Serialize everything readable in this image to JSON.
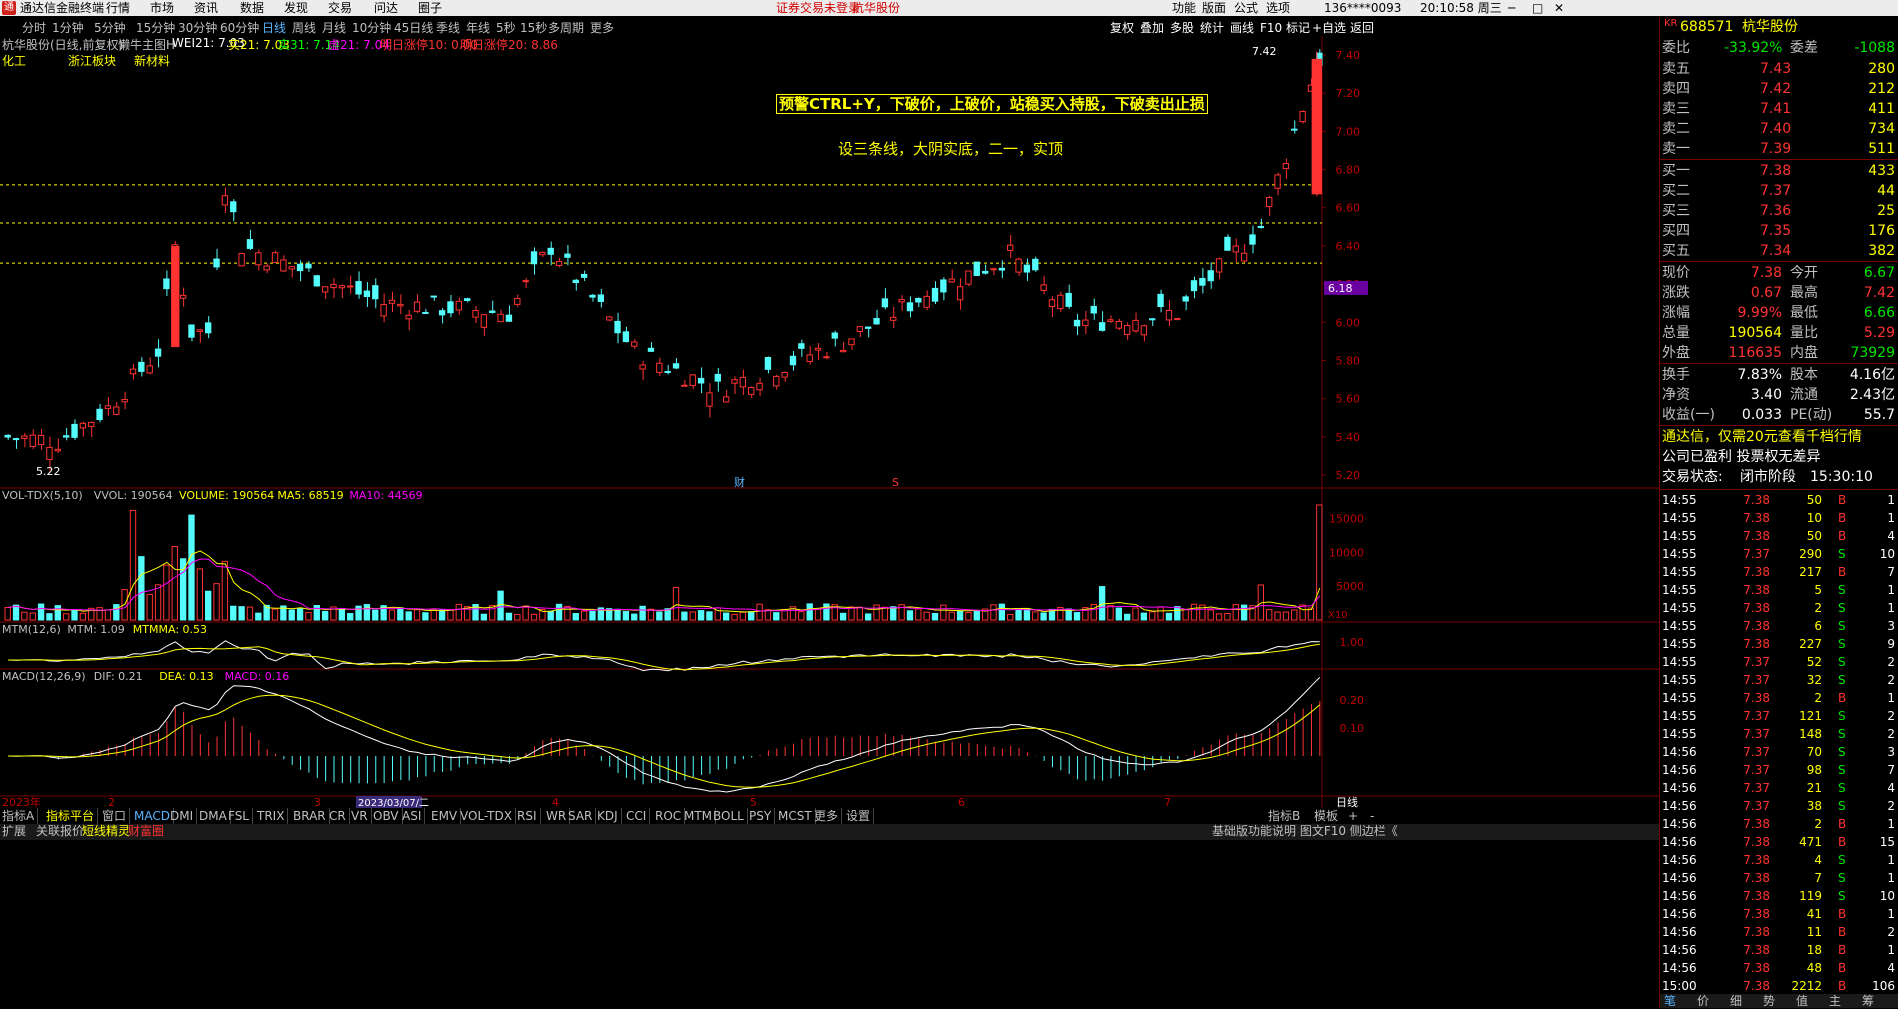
{
  "menubar": {
    "app_title": "通达信金融终端",
    "menus": [
      "行情",
      "市场",
      "资讯",
      "数据",
      "发现",
      "交易",
      "问达",
      "圈子"
    ],
    "notice": "证券交易未登录",
    "stock_name": "杭华股份",
    "right": [
      "功能",
      "版面",
      "公式",
      "选项"
    ],
    "user": "136****0093",
    "time": "20:10:58 周三"
  },
  "periodbar": {
    "items": [
      "分时",
      "1分钟",
      "5分钟",
      "15分钟",
      "30分钟",
      "60分钟",
      "日线",
      "周线",
      "月线",
      "10分钟",
      "45日线",
      "季线",
      "年线",
      "5秒",
      "15秒",
      "多周期",
      "更多"
    ],
    "active": "日线",
    "right_buttons": [
      "复权",
      "叠加",
      "多股",
      "统计",
      "画线",
      "F10",
      "标记",
      "+自选",
      "返回"
    ]
  },
  "info": {
    "title": "杭华股份(日线,前复权)",
    "indicator": "懒牛主图H",
    "wei21": "WEI21: 7.03",
    "shi21": "实21: 7.03",
    "shi31": "实31: 7.14",
    "xu21": "虚21: 7.04",
    "zt10": "明日涨停10: 0.00",
    "zt20": "明日涨停20: 8.86",
    "tags": [
      "化工",
      "浙江板块",
      "新材料"
    ],
    "annotation1": "预警CTRL+Y，下破价，上破价，站稳买入持股，下破卖出止损",
    "annotation2": "设三条线，大阴实底，二一，实顶",
    "high_label": "7.42",
    "low_label": "5.22",
    "cur_price_tag": "6.18",
    "marker_cai": "财",
    "marker_s": "S"
  },
  "price_axis": [
    "7.40",
    "7.20",
    "7.00",
    "6.80",
    "6.60",
    "6.40",
    "6.20",
    "6.00",
    "5.80",
    "5.60",
    "5.40",
    "5.20"
  ],
  "vol": {
    "title": "VOL-TDX(5,10)",
    "vvol": "VVOL: 190564",
    "volume": "VOLUME: 190564",
    "ma5": "MA5: 68519",
    "ma10": "MA10: 44569",
    "axis": [
      "15000",
      "10000",
      "5000"
    ],
    "unit": "X10"
  },
  "mtm": {
    "title": "MTM(12,6)",
    "mtm": "MTM: 1.09",
    "mtmma": "MTMMA: 0.53",
    "axis": [
      "1.00"
    ]
  },
  "macd": {
    "title": "MACD(12,26,9)",
    "dif": "DIF: 0.21",
    "dea": "DEA: 0.13",
    "macd": "MACD: 0.16",
    "axis": [
      "0.20",
      "0.10"
    ]
  },
  "xaxis": {
    "labels": [
      "2023年",
      "2",
      "3",
      "4",
      "5",
      "6",
      "7"
    ],
    "highlight": "2023/03/07/二",
    "right_label": "日线"
  },
  "tabs": {
    "items": [
      "指标A",
      "指标平台",
      "窗口",
      "MACD",
      "DMI",
      "DMA",
      "FSL",
      "TRIX",
      "BRAR",
      "CR",
      "VR",
      "OBV",
      "ASI",
      "EMV",
      "VOL-TDX",
      "RSI",
      "WR",
      "SAR",
      "KDJ",
      "CCI",
      "ROC",
      "MTM",
      "BOLL",
      "PSY",
      "MCST",
      "更多",
      "设置"
    ],
    "active": "MACD",
    "right": [
      "指标B",
      "模板",
      "+",
      "-"
    ]
  },
  "bottombar": {
    "items": [
      "扩展",
      "关联报价",
      "短线精灵",
      "财富圈"
    ],
    "right_text": "基础版功能说明 图文F10 侧边栏《",
    "right_tabs": [
      "笔",
      "价",
      "细",
      "势",
      "值",
      "主",
      "筹"
    ]
  },
  "quote": {
    "code": "688571",
    "name": "杭华股份",
    "market": "KR",
    "weibi_label": "委比",
    "weibi": "-33.92%",
    "weicha_label": "委差",
    "weicha": "-1088",
    "asks": [
      {
        "label": "卖五",
        "price": "7.43",
        "vol": "280"
      },
      {
        "label": "卖四",
        "price": "7.42",
        "vol": "212"
      },
      {
        "label": "卖三",
        "price": "7.41",
        "vol": "411"
      },
      {
        "label": "卖二",
        "price": "7.40",
        "vol": "734"
      },
      {
        "label": "卖一",
        "price": "7.39",
        "vol": "511"
      }
    ],
    "bids": [
      {
        "label": "买一",
        "price": "7.38",
        "vol": "433"
      },
      {
        "label": "买二",
        "price": "7.37",
        "vol": "44"
      },
      {
        "label": "买三",
        "price": "7.36",
        "vol": "25"
      },
      {
        "label": "买四",
        "price": "7.35",
        "vol": "176"
      },
      {
        "label": "买五",
        "price": "7.34",
        "vol": "382"
      }
    ],
    "stats": [
      {
        "l1": "现价",
        "v1": "7.38",
        "c1": "red",
        "l2": "今开",
        "v2": "6.67",
        "c2": "green"
      },
      {
        "l1": "涨跌",
        "v1": "0.67",
        "c1": "red",
        "l2": "最高",
        "v2": "7.42",
        "c2": "red"
      },
      {
        "l1": "涨幅",
        "v1": "9.99%",
        "c1": "red",
        "l2": "最低",
        "v2": "6.66",
        "c2": "green"
      },
      {
        "l1": "总量",
        "v1": "190564",
        "c1": "yellow",
        "l2": "量比",
        "v2": "5.29",
        "c2": "red"
      },
      {
        "l1": "外盘",
        "v1": "116635",
        "c1": "red",
        "l2": "内盘",
        "v2": "73929",
        "c2": "green"
      }
    ],
    "stats2": [
      {
        "l1": "换手",
        "v1": "7.83%",
        "l2": "股本",
        "v2": "4.16亿"
      },
      {
        "l1": "净资",
        "v1": "3.40",
        "l2": "流通",
        "v2": "2.43亿"
      },
      {
        "l1": "收益(一)",
        "v1": "0.033",
        "l2": "PE(动)",
        "v2": "55.7"
      }
    ],
    "promo": "通达信，仅需20元查看千档行情",
    "company": "公司已盈利 投票权无差异",
    "status_label": "交易状态:",
    "status": "闭市阶段",
    "status_time": "15:30:10"
  },
  "ticks": [
    [
      "14:55",
      "7.38",
      "50",
      "B",
      "1"
    ],
    [
      "14:55",
      "7.38",
      "10",
      "B",
      "1"
    ],
    [
      "14:55",
      "7.38",
      "50",
      "B",
      "4"
    ],
    [
      "14:55",
      "7.37",
      "290",
      "S",
      "10"
    ],
    [
      "14:55",
      "7.38",
      "217",
      "B",
      "7"
    ],
    [
      "14:55",
      "7.38",
      "5",
      "S",
      "1"
    ],
    [
      "14:55",
      "7.38",
      "2",
      "S",
      "1"
    ],
    [
      "14:55",
      "7.38",
      "6",
      "S",
      "3"
    ],
    [
      "14:55",
      "7.38",
      "227",
      "S",
      "9"
    ],
    [
      "14:55",
      "7.37",
      "52",
      "S",
      "2"
    ],
    [
      "14:55",
      "7.37",
      "32",
      "S",
      "2"
    ],
    [
      "14:55",
      "7.38",
      "2",
      "B",
      "1"
    ],
    [
      "14:55",
      "7.37",
      "121",
      "S",
      "2"
    ],
    [
      "14:55",
      "7.37",
      "148",
      "S",
      "2"
    ],
    [
      "14:56",
      "7.37",
      "70",
      "S",
      "3"
    ],
    [
      "14:56",
      "7.37",
      "98",
      "S",
      "7"
    ],
    [
      "14:56",
      "7.37",
      "21",
      "S",
      "4"
    ],
    [
      "14:56",
      "7.37",
      "38",
      "S",
      "2"
    ],
    [
      "14:56",
      "7.38",
      "2",
      "B",
      "1"
    ],
    [
      "14:56",
      "7.38",
      "471",
      "B",
      "15"
    ],
    [
      "14:56",
      "7.38",
      "4",
      "S",
      "1"
    ],
    [
      "14:56",
      "7.38",
      "7",
      "S",
      "1"
    ],
    [
      "14:56",
      "7.38",
      "119",
      "S",
      "10"
    ],
    [
      "14:56",
      "7.38",
      "41",
      "B",
      "1"
    ],
    [
      "14:56",
      "7.38",
      "11",
      "B",
      "2"
    ],
    [
      "14:56",
      "7.38",
      "18",
      "B",
      "1"
    ],
    [
      "14:56",
      "7.38",
      "48",
      "B",
      "4"
    ],
    [
      "15:00",
      "7.38",
      "2212",
      "B",
      "106"
    ]
  ],
  "colors": {
    "up": "#ff3232",
    "down": "#54fcfc",
    "ma_yellow": "#ffff00",
    "ma_magenta": "#ff00ff",
    "ma_white": "#ffffff",
    "accent_blue": "#5ab5ff"
  }
}
